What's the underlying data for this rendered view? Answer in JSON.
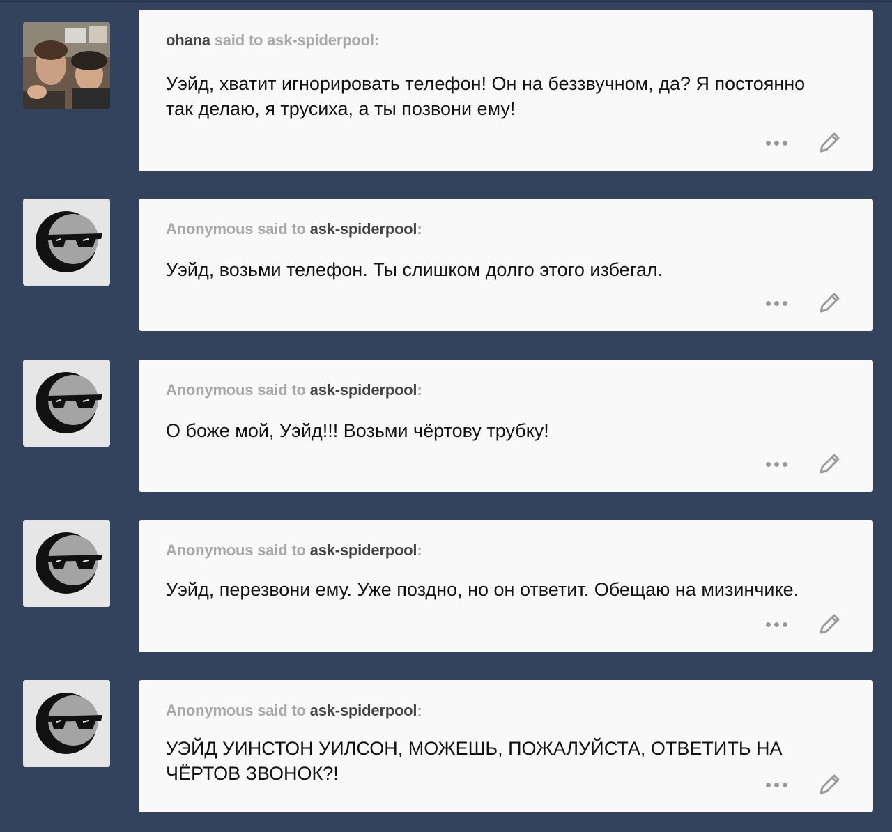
{
  "posts": [
    {
      "asker": "ohana",
      "verb": "said to",
      "blog": "ask-spiderpool",
      "colon": ":",
      "asker_style": "named",
      "avatar": "photo",
      "text": "Уэйд, хватит игнорировать телефон! Он на беззвучном, да? Я постоянно так делаю, я трусиха, а ты позвони ему!"
    },
    {
      "asker": "Anonymous",
      "verb": "said to",
      "blog": "ask-spiderpool",
      "colon": ":",
      "asker_style": "anon",
      "avatar": "anon",
      "text": "Уэйд, возьми телефон. Ты слишком долго этого избегал."
    },
    {
      "asker": "Anonymous",
      "verb": "said to",
      "blog": "ask-spiderpool",
      "colon": ":",
      "asker_style": "anon",
      "avatar": "anon",
      "text": "О боже мой, Уэйд!!! Возьми чёртову трубку!"
    },
    {
      "asker": "Anonymous",
      "verb": "said to",
      "blog": "ask-spiderpool",
      "colon": ":",
      "asker_style": "anon",
      "avatar": "anon",
      "text": "Уэйд, перезвони ему. Уже поздно, но он ответит. Обещаю на мизинчике."
    },
    {
      "asker": "Anonymous",
      "verb": "said to",
      "blog": "ask-spiderpool",
      "colon": ":",
      "asker_style": "anon",
      "avatar": "anon",
      "text": "УЭЙД УИНСТОН УИЛСОН, МОЖЕШЬ, ПОЖАЛУЙСТА, ОТВЕТИТЬ НА ЧЁРТОВ ЗВОНОК?!"
    }
  ],
  "icons": {
    "more": "more-dots-icon",
    "edit": "pencil-icon",
    "anon_avatar": "anonymous-sunglasses-avatar",
    "photo_avatar": "user-photo-avatar"
  },
  "colors": {
    "background": "#34435d",
    "card": "#f9f9f9",
    "text": "#111111",
    "meta_grey": "#a8a8a8",
    "meta_dark": "#444444"
  }
}
